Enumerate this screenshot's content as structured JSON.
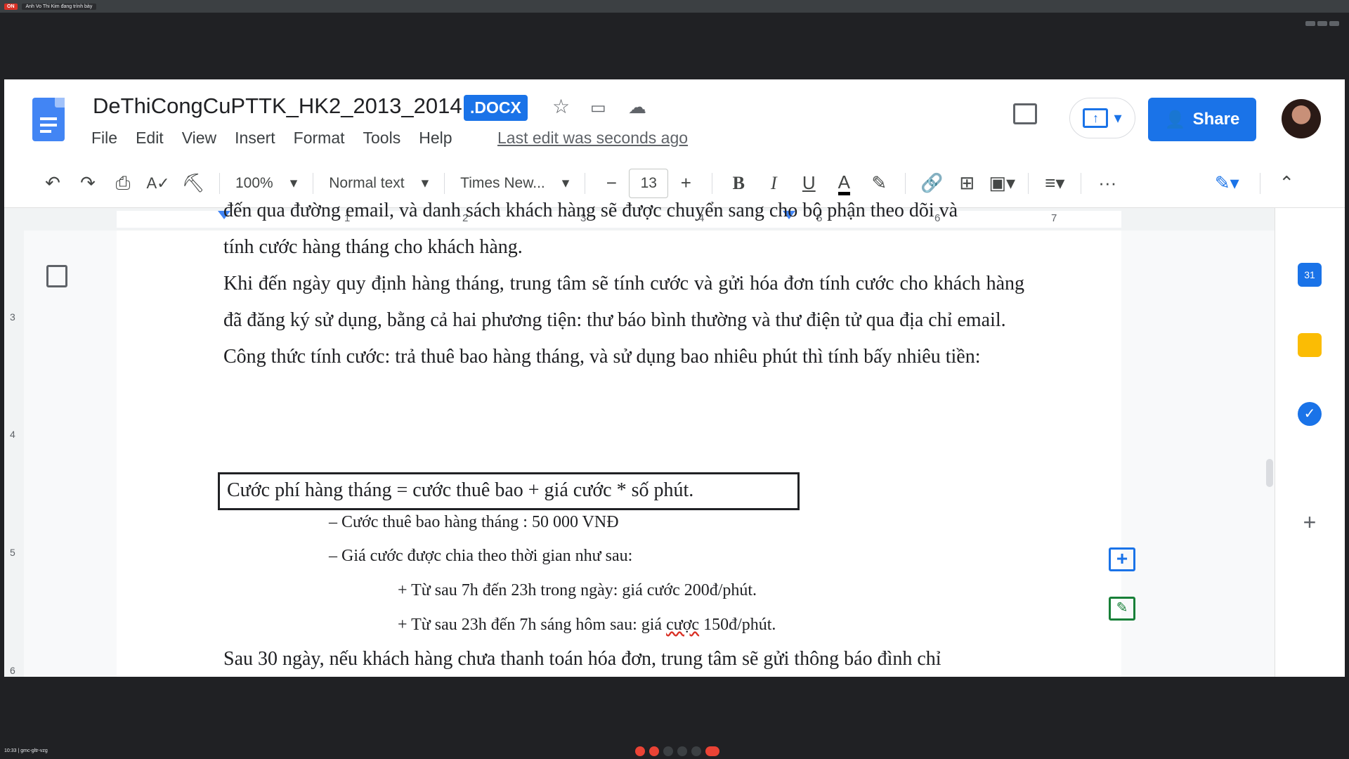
{
  "meet": {
    "rec_label": "ON",
    "presenter_label": "Anh Vo Thi Kim đang trình bày",
    "time_code": "10:33 | gmc-gltr-vzg"
  },
  "doc": {
    "title": "DeThiCongCuPTTK_HK2_2013_2014",
    "badge": ".DOCX",
    "menu": [
      "File",
      "Edit",
      "View",
      "Insert",
      "Format",
      "Tools",
      "Help"
    ],
    "last_edit": "Last edit was seconds ago",
    "share_label": "Share"
  },
  "toolbar": {
    "zoom": "100%",
    "style": "Normal text",
    "font": "Times New...",
    "font_size": "13",
    "more": "···"
  },
  "ruler": {
    "h_numbers": [
      "1",
      "2",
      "3",
      "4",
      "5",
      "6",
      "7"
    ],
    "v_numbers": [
      "3",
      "4",
      "5",
      "6"
    ]
  },
  "content": {
    "cut_line": "đến qua đường email, và danh sách khách hàng sẽ được chuyển sang cho bộ phận theo dõi và",
    "p1_line2": "tính cước hàng tháng cho khách hàng.",
    "p2": "Khi đến ngày quy định hàng tháng, trung tâm sẽ tính cước và gửi hóa đơn tính cước cho khách hàng đã đăng ký sử dụng, bằng cả hai phương tiện: thư báo bình thường và thư điện tử qua địa chỉ email.",
    "p3": "Công thức tính cước: trả thuê bao hàng tháng, và sử dụng bao nhiêu phút thì tính bấy nhiêu tiền:",
    "formula": "Cước phí hàng tháng = cước thuê bao + giá cước * số phút.",
    "bullet1": "– Cước thuê bao hàng tháng : 50 000 VNĐ",
    "bullet2": "– Giá cước được chia theo thời gian như sau:",
    "sub1": "+ Từ sau 7h đến 23h trong ngày: giá cước 200đ/phút.",
    "sub2_a": "+ Từ sau 23h đến 7h sáng hôm sau: giá ",
    "sub2_b": "cược",
    "sub2_c": " 150đ/phút.",
    "last_line": "Sau 30 ngày, nếu khách hàng chưa thanh toán hóa đơn, trung tâm sẽ gửi thông báo đình chỉ"
  },
  "colors": {
    "accent": "#1a73e8",
    "doc_blue": "#4285f4"
  }
}
